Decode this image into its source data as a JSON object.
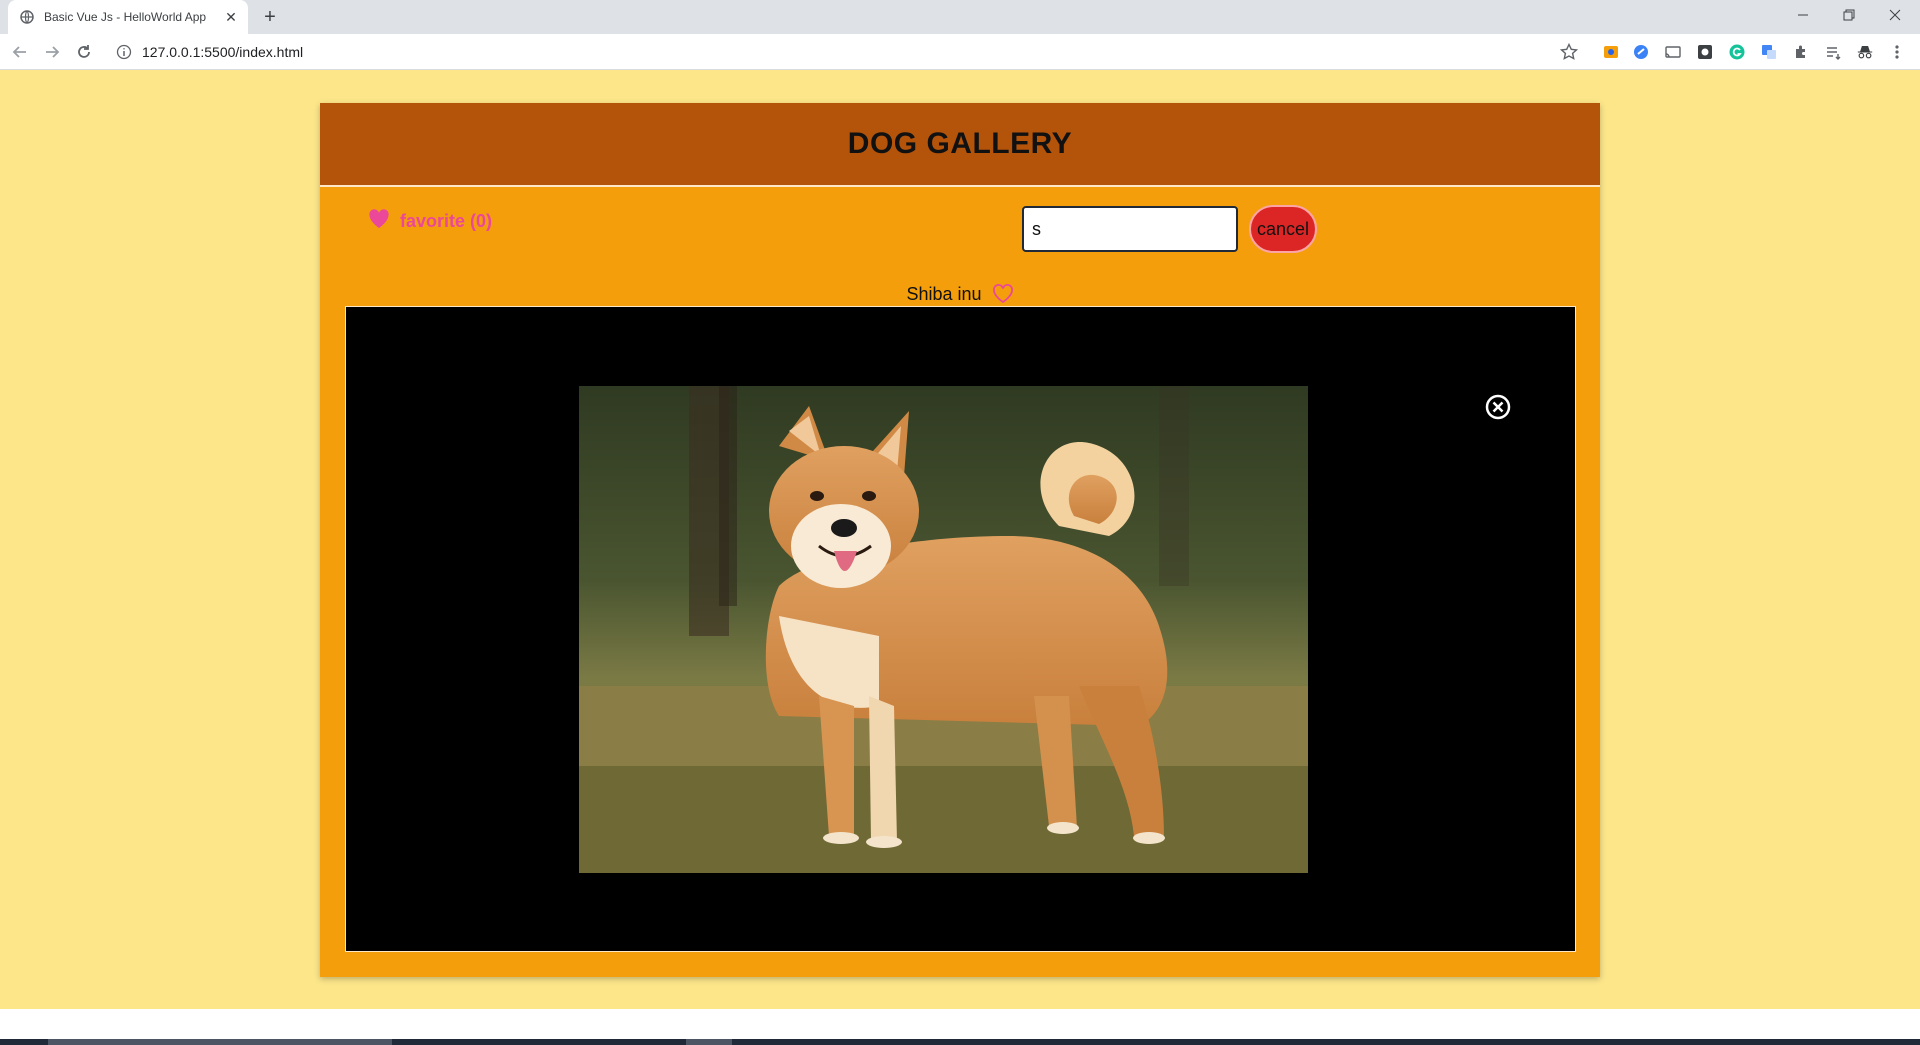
{
  "browser": {
    "tab_title": "Basic Vue Js - HelloWorld App",
    "tab_close": "✕",
    "new_tab": "+",
    "url": "127.0.0.1:5500/index.html"
  },
  "app": {
    "title": "DOG GALLERY",
    "favorites_label": "favorite (0)",
    "search": {
      "value": "s",
      "placeholder": ""
    },
    "cancel_label": "cancel",
    "selected_breed": "Shiba inu"
  },
  "colors": {
    "page_bg": "#fde68a",
    "card_bg": "#f59e0b",
    "header_bg": "#b4530a",
    "favorite_pink": "#ec4899",
    "cancel_red": "#dc2626"
  },
  "icons": {
    "favorites": "heart-filled-icon",
    "breed_favorite": "heart-outline-icon",
    "close_viewer": "close-circle-icon"
  }
}
